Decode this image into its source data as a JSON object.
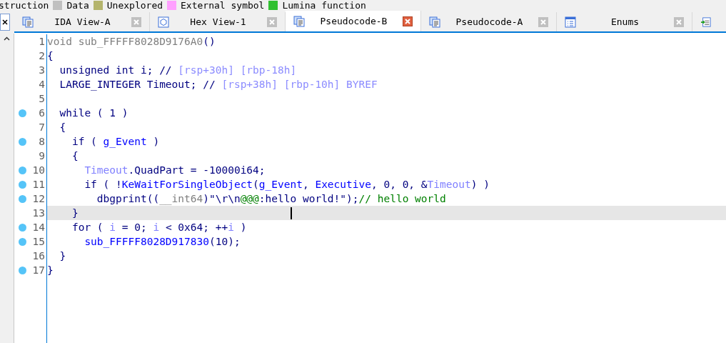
{
  "legend": [
    {
      "label": "struction"
    },
    {
      "label": "Data",
      "color": "#c0c0c0"
    },
    {
      "label": "Unexplored",
      "color": "#b4b46c"
    },
    {
      "label": "External symbol",
      "color": "#ffa0ff"
    },
    {
      "label": "Lumina function",
      "color": "#30c030"
    }
  ],
  "tabs": [
    {
      "label": "IDA View-A",
      "selected": false
    },
    {
      "label": "Hex View-1",
      "selected": false
    },
    {
      "label": "Pseudocode-B",
      "selected": true
    },
    {
      "label": "Pseudocode-A",
      "selected": false
    },
    {
      "label": "Enums",
      "selected": false
    }
  ],
  "lines": [
    {
      "number": "1",
      "breakpoint": false,
      "current": false,
      "tokens": [
        {
          "text": "void sub_FFFFF8028D9176A0",
          "kind": "header"
        },
        {
          "text": "()",
          "kind": "plain"
        }
      ]
    },
    {
      "number": "2",
      "breakpoint": false,
      "current": false,
      "tokens": [
        {
          "text": "{",
          "kind": "plain"
        }
      ]
    },
    {
      "number": "3",
      "breakpoint": false,
      "current": false,
      "tokens": [
        {
          "text": "  unsigned int i; // ",
          "kind": "plain"
        },
        {
          "text": "[rsp+30h] [rbp-18h]",
          "kind": "note"
        }
      ]
    },
    {
      "number": "4",
      "breakpoint": false,
      "current": false,
      "tokens": [
        {
          "text": "  LARGE_INTEGER Timeout; // ",
          "kind": "plain"
        },
        {
          "text": "[rsp+38h] [rbp-10h] BYREF",
          "kind": "note"
        }
      ]
    },
    {
      "number": "5",
      "breakpoint": false,
      "current": false
    },
    {
      "number": "6",
      "breakpoint": true,
      "current": false,
      "tokens": [
        {
          "text": "  while ( 1 )",
          "kind": "plain"
        }
      ]
    },
    {
      "number": "7",
      "breakpoint": false,
      "current": false,
      "tokens": [
        {
          "text": "  {",
          "kind": "plain"
        }
      ]
    },
    {
      "number": "8",
      "breakpoint": true,
      "current": false,
      "tokens": [
        {
          "text": "    if ( ",
          "kind": "plain"
        },
        {
          "text": "g_Event",
          "kind": "global"
        },
        {
          "text": " )",
          "kind": "plain"
        }
      ]
    },
    {
      "number": "9",
      "breakpoint": false,
      "current": false,
      "tokens": [
        {
          "text": "    {",
          "kind": "plain"
        }
      ]
    },
    {
      "number": "10",
      "breakpoint": true,
      "current": false,
      "tokens": [
        {
          "text": "      Timeout",
          "kind": "local"
        },
        {
          "text": ".QuadPart = -10000i64;",
          "kind": "plain"
        }
      ]
    },
    {
      "number": "11",
      "breakpoint": true,
      "current": false,
      "tokens": [
        {
          "text": "      if ( !",
          "kind": "plain"
        },
        {
          "text": "KeWaitForSingleObject",
          "kind": "global"
        },
        {
          "text": "(",
          "kind": "plain"
        },
        {
          "text": "g_Event",
          "kind": "global"
        },
        {
          "text": ", ",
          "kind": "plain"
        },
        {
          "text": "Executive",
          "kind": "global"
        },
        {
          "text": ", 0, 0, &",
          "kind": "plain"
        },
        {
          "text": "Timeout",
          "kind": "local"
        },
        {
          "text": ") )",
          "kind": "plain"
        }
      ]
    },
    {
      "number": "12",
      "breakpoint": true,
      "current": false,
      "tokens": [
        {
          "text": "        dbgprint((",
          "kind": "plain"
        },
        {
          "text": "__int64",
          "kind": "header"
        },
        {
          "text": ")\"\\r\\n",
          "kind": "plain"
        },
        {
          "text": "@@@",
          "kind": "comment"
        },
        {
          "text": ":hello world!\");",
          "kind": "plain"
        },
        {
          "text": "// hello world",
          "kind": "comment"
        }
      ]
    },
    {
      "number": "13",
      "breakpoint": false,
      "current": true,
      "tokens": [
        {
          "text": "    }",
          "kind": "plain"
        }
      ]
    },
    {
      "number": "14",
      "breakpoint": true,
      "current": false,
      "tokens": [
        {
          "text": "    for ( ",
          "kind": "plain"
        },
        {
          "text": "i",
          "kind": "local"
        },
        {
          "text": " = 0; ",
          "kind": "plain"
        },
        {
          "text": "i",
          "kind": "local"
        },
        {
          "text": " < 0x64; ++",
          "kind": "plain"
        },
        {
          "text": "i",
          "kind": "local"
        },
        {
          "text": " )",
          "kind": "plain"
        }
      ]
    },
    {
      "number": "15",
      "breakpoint": true,
      "current": false,
      "tokens": [
        {
          "text": "      sub_FFFFF8028D917830",
          "kind": "global"
        },
        {
          "text": "(10);",
          "kind": "plain"
        }
      ]
    },
    {
      "number": "16",
      "breakpoint": false,
      "current": false,
      "tokens": [
        {
          "text": "  }",
          "kind": "plain"
        }
      ]
    },
    {
      "number": "17",
      "breakpoint": true,
      "current": false,
      "tokens": [
        {
          "text": "}",
          "kind": "plain"
        }
      ]
    }
  ]
}
